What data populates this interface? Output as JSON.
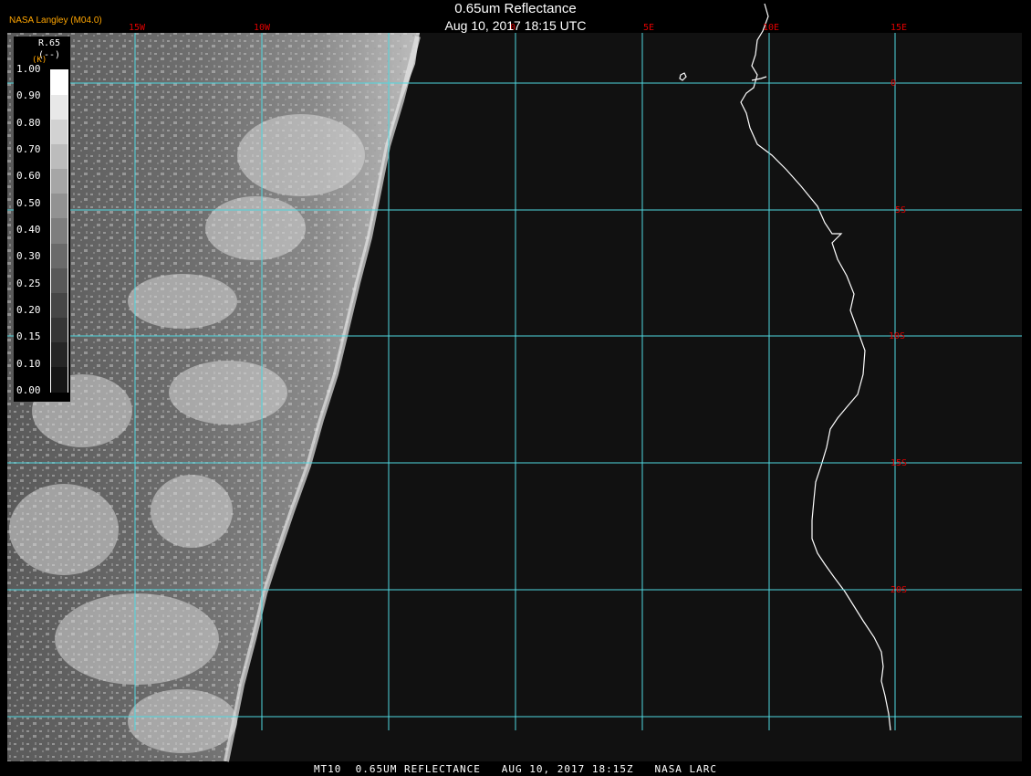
{
  "header": {
    "title": "0.65um Reflectance",
    "subtitle": "Aug 10, 2017 18:15 UTC",
    "provider": "NASA Langley (M04.0)"
  },
  "legend": {
    "variable": "R.65",
    "unit": "(--)",
    "unit_tag": "(K)",
    "ticks": [
      "1.00",
      "0.90",
      "0.80",
      "0.70",
      "0.60",
      "0.50",
      "0.40",
      "0.30",
      "0.25",
      "0.20",
      "0.15",
      "0.10",
      "0.00"
    ],
    "colors": [
      "#ffffff",
      "#e8e8e8",
      "#d2d2d2",
      "#bcbcbc",
      "#a6a6a6",
      "#929292",
      "#7e7e7e",
      "#6a6a6a",
      "#585858",
      "#464646",
      "#363636",
      "#262626",
      "#161616"
    ]
  },
  "map": {
    "longitude_labels": [
      "15W",
      "10W",
      "0",
      "5E",
      "10E",
      "15E"
    ],
    "latitude_labels": [
      "0",
      "5S",
      "10S",
      "15S",
      "20S"
    ],
    "grid_color": "#4fd8e0",
    "label_color": "#e00000"
  },
  "footer": {
    "text": "MT10  0.65UM REFLECTANCE   AUG 10, 2017 18:15Z   NASA LARC"
  }
}
